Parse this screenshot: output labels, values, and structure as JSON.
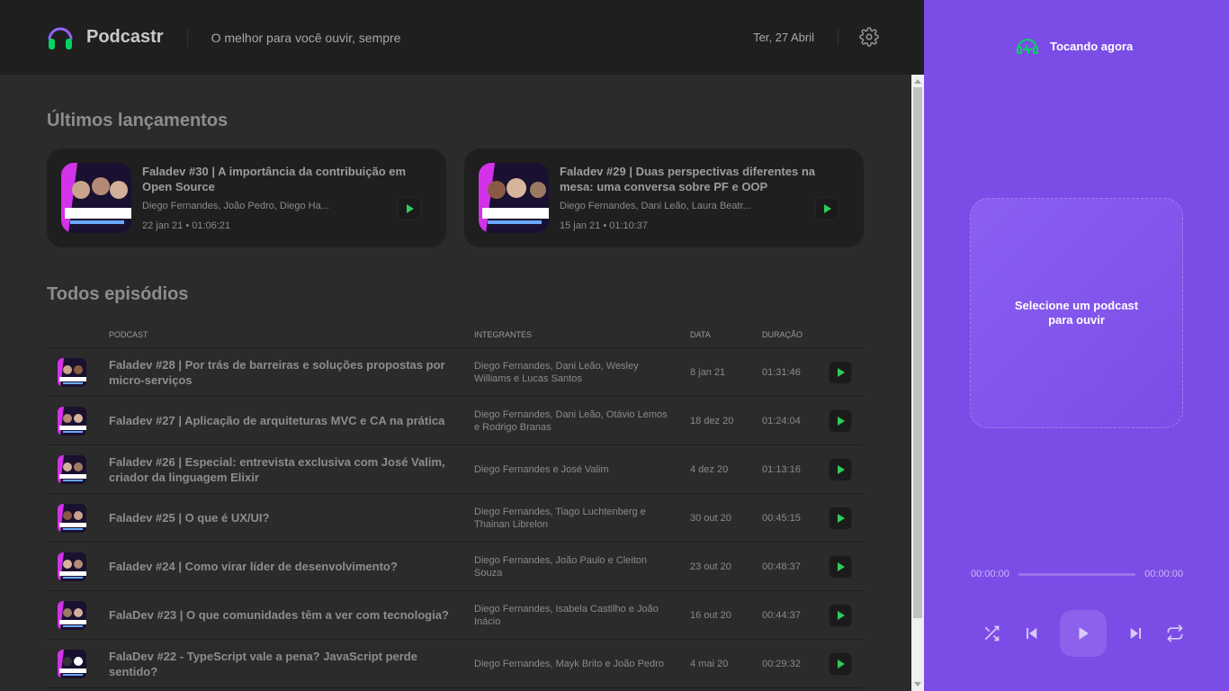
{
  "header": {
    "app_name": "Podcastr",
    "tagline": "O melhor para você ouvir, sempre",
    "date": "Ter, 27 Abril"
  },
  "latest": {
    "title": "Últimos lançamentos",
    "episodes": [
      {
        "title": "Faladev #30 | A importância da contribuição em Open Source",
        "members": "Diego Fernandes, João Pedro, Diego Ha...",
        "date": "22 jan 21",
        "duration": "01:06:21",
        "meta": "22 jan 21 • 01:06:21"
      },
      {
        "title": "Faladev #29 | Duas perspectivas diferentes na mesa: uma conversa sobre PF e OOP",
        "members": "Diego Fernandes, Dani Leão, Laura Beatr...",
        "date": "15 jan 21",
        "duration": "01:10:37",
        "meta": "15 jan 21 • 01:10:37"
      }
    ]
  },
  "all": {
    "title": "Todos episódios",
    "columns": [
      "Podcast",
      "Integrantes",
      "Data",
      "Duração"
    ],
    "episodes": [
      {
        "title": "Faladev #28 | Por trás de barreiras e soluções propostas por micro-serviços",
        "members": "Diego Fernandes, Dani Leão, Wesley Williams e Lucas Santos",
        "date": "8 jan 21",
        "duration": "01:31:46"
      },
      {
        "title": "Faladev #27 | Aplicação de arquiteturas MVC e CA na prática",
        "members": "Diego Fernandes, Dani Leão, Otávio Lemos e Rodrigo Branas",
        "date": "18 dez 20",
        "duration": "01:24:04"
      },
      {
        "title": "Faladev #26 | Especial: entrevista exclusiva com José Valim, criador da linguagem Elixir",
        "members": "Diego Fernandes e José Valim",
        "date": "4 dez 20",
        "duration": "01:13:16"
      },
      {
        "title": "Faladev #25 | O que é UX/UI?",
        "members": "Diego Fernandes, Tiago Luchtenberg e Thainan Librelon",
        "date": "30 out 20",
        "duration": "00:45:15"
      },
      {
        "title": "Faladev #24 | Como virar líder de desenvolvimento?",
        "members": "Diego Fernandes, João Paulo e Cleiton Souza",
        "date": "23 out 20",
        "duration": "00:48:37"
      },
      {
        "title": "FalaDev #23 | O que comunidades têm a ver com tecnologia?",
        "members": "Diego Fernandes, Isabela Castilho e João Inácio",
        "date": "16 out 20",
        "duration": "00:44:37"
      },
      {
        "title": "FalaDev #22 - TypeScript vale a pena? JavaScript perde sentido?",
        "members": "Diego Fernandes, Mayk Brito e João Pedro",
        "date": "4 mai 20",
        "duration": "00:29:32"
      }
    ]
  },
  "player": {
    "title": "Tocando agora",
    "empty_message": "Selecione um podcast para ouvir",
    "current_time": "00:00:00",
    "total_time": "00:00:00",
    "progress": 0
  },
  "colors": {
    "accent": "#7b4de6",
    "play_green": "#2ecc5a",
    "background": "#2b2b2b",
    "header": "#1f1f1f"
  }
}
